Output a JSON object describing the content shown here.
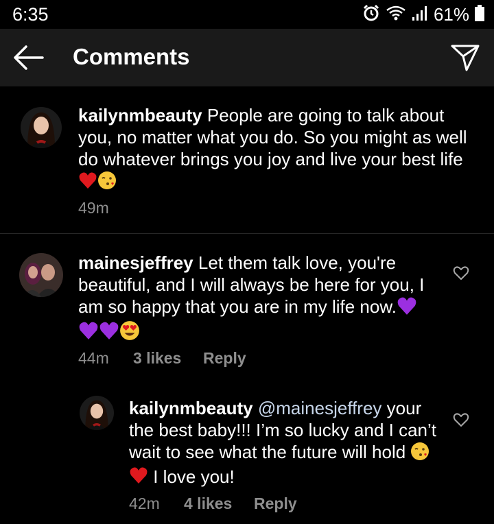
{
  "status_bar": {
    "time": "6:35",
    "battery_percent": "61%",
    "icons": [
      "alarm-icon",
      "wifi-icon",
      "signal-icon",
      "battery-icon"
    ]
  },
  "header": {
    "title": "Comments",
    "back_icon": "arrow-left-icon",
    "share_icon": "paper-plane-icon"
  },
  "comments": [
    {
      "username": "kailynmbeauty",
      "text": "People are going to talk about you, no matter what you do. So you might as well do whatever brings you joy and live your best life",
      "emojis": [
        "red-heart",
        "face-blowing-kiss"
      ],
      "time": "49m"
    },
    {
      "username": "mainesjeffrey",
      "text": "Let them talk love, you're beautiful, and I will always be here for you, I am so happy that you are in my life now.",
      "emojis": [
        "purple-heart",
        "purple-heart",
        "purple-heart",
        "heart-eyes"
      ],
      "time": "44m",
      "likes": "3 likes",
      "reply_label": "Reply"
    },
    {
      "username": "kailynmbeauty",
      "mention": "@mainesjeffrey",
      "text": "your the best baby!!! I’m so lucky and I can’t wait to see what the future will hold",
      "text_after_emoji": "I love you!",
      "emojis": [
        "face-blowing-kiss",
        "red-heart"
      ],
      "time": "42m",
      "likes": "4 likes",
      "reply_label": "Reply"
    }
  ],
  "colors": {
    "background": "#000000",
    "app_bar": "#1a1a1a",
    "text": "#ffffff",
    "meta": "#8e8e8e",
    "divider": "#262626"
  }
}
